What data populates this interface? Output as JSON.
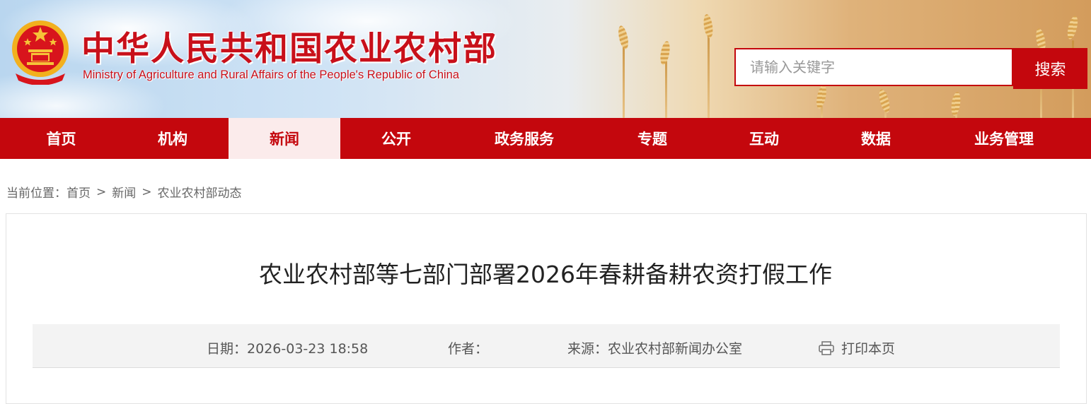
{
  "header": {
    "title": "中华人民共和国农业农村部",
    "subtitle": "Ministry of Agriculture and Rural Affairs of the People's Republic of China"
  },
  "search": {
    "placeholder": "请输入关键字",
    "button_label": "搜索"
  },
  "nav": {
    "items": [
      {
        "label": "首页"
      },
      {
        "label": "机构"
      },
      {
        "label": "新闻",
        "active": true
      },
      {
        "label": "公开"
      },
      {
        "label": "政务服务"
      },
      {
        "label": "专题"
      },
      {
        "label": "互动"
      },
      {
        "label": "数据"
      },
      {
        "label": "业务管理"
      }
    ]
  },
  "breadcrumb": {
    "prefix": "当前位置：",
    "items": [
      "首页",
      "新闻",
      "农业农村部动态"
    ],
    "separator": ">"
  },
  "article": {
    "title": "农业农村部等七部门部署2026年春耕备耕农资打假工作",
    "date_label": "日期：",
    "date": "2026-03-23 18:58",
    "author_label": "作者：",
    "author": "",
    "source_label": "来源：",
    "source": "农业农村部新闻办公室",
    "print_label": "打印本页"
  },
  "colors": {
    "brand_red": "#c4070d",
    "active_tab_bg": "#fbebeb"
  },
  "icons": {
    "emblem": "national-emblem-icon",
    "print": "printer-icon"
  }
}
